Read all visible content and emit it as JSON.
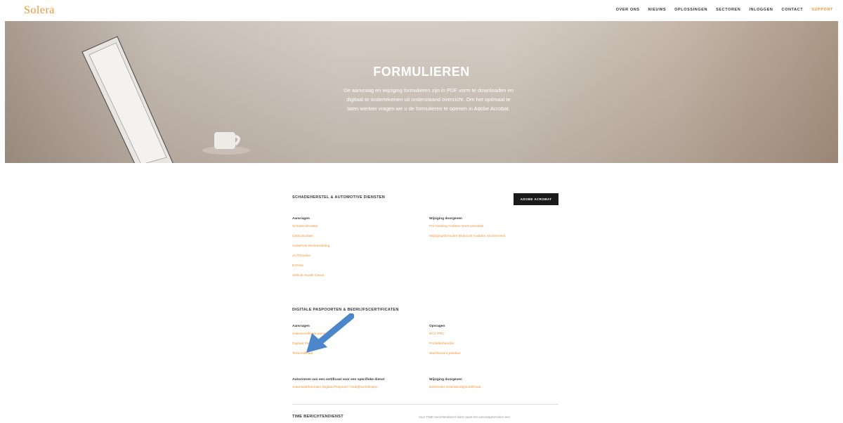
{
  "brand": {
    "logo": "Solera",
    "accent": "#f39434"
  },
  "nav": [
    "OVER ONS",
    "NIEUWS",
    "OPLOSSINGEN",
    "SECTOREN",
    "INLOGGEN",
    "CONTACT",
    "SUPPORT"
  ],
  "hero": {
    "title": "FORMULIEREN",
    "lines": [
      "De aanvraag en wijziging formulieren zijn in PDF vorm te downloaden en",
      "digitaal te ondertekenen uit onderstaand overzicht. Om het optimaal te",
      "laten werken vragen we u de formulieren te openen in Adobe Acrobat."
    ]
  },
  "section1": {
    "title": "SCHADEHERSTEL & AUTOMOTIVE DIENSTEN",
    "button": "ADOBE ACROBAT",
    "left_head": "Aanvragen",
    "left_links": [
      "Schadecalculatie",
      "Glascalculatie",
      "AudaFlow Werkverdeling",
      "AUTOonline",
      "EzFlow",
      "Vehicle Health Check"
    ],
    "right_head": "Wijziging doorgeven",
    "right_links": [
      "Pre-melding Audatex Normcalculatie",
      "Wijzigingsformulier Bruincost Audatex Abonnement"
    ]
  },
  "section2": {
    "title": "DIGITALE PASPOORTEN & BEDRIJFSCERTIFICATEN",
    "left_head": "Aanvragen",
    "left_links": [
      "Soleracertificaat aanvragen",
      "Digitaal Paspoort",
      "Testcertificaat"
    ],
    "right_head": "Opvragen",
    "right_links": [
      "BCC-PRC",
      "Profielbeheerder",
      "Wachtwoord postbus"
    ],
    "left_head2": "Autoriseren van een certificaat voor een specifieke dienst",
    "left_link2": "Autorisatieformulier Digitaal Paspoort / bedrijfscertificaten",
    "right_head2": "Wijziging doorgeven",
    "right_link2": "Beheerder Solerabedrijfscertificaat"
  },
  "section3": {
    "title": "TIME BERICHTENDIENST",
    "note": "Voor TIME berichtendienst dient naast het aanvraagformulier een"
  }
}
